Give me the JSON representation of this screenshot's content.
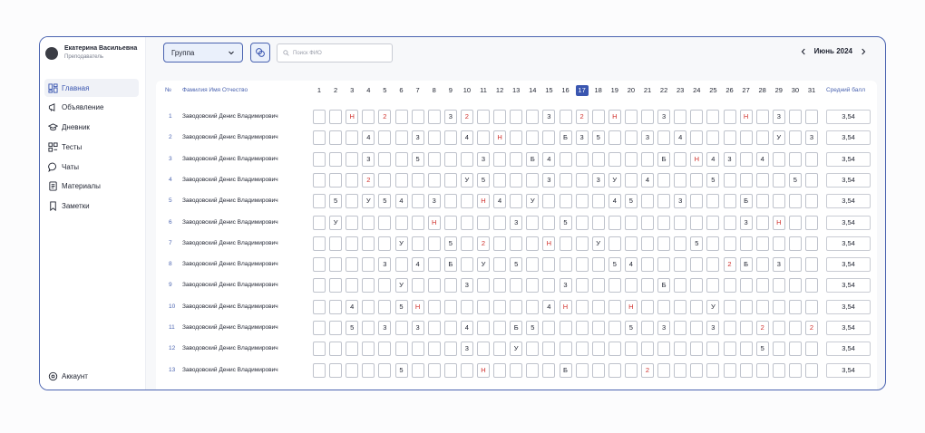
{
  "profile": {
    "name": "Екатерина Васильевна",
    "role": "Преподаватель"
  },
  "nav": [
    {
      "label": "Главная",
      "icon": "dashboard-icon",
      "active": true
    },
    {
      "label": "Объявление",
      "icon": "megaphone-icon"
    },
    {
      "label": "Дневник",
      "icon": "graduation-cap-icon"
    },
    {
      "label": "Тесты",
      "icon": "tests-icon"
    },
    {
      "label": "Чаты",
      "icon": "chat-icon"
    },
    {
      "label": "Материалы",
      "icon": "document-icon"
    },
    {
      "label": "Заметки",
      "icon": "bookmark-icon"
    }
  ],
  "account_label": "Аккаунт",
  "toolbar": {
    "group_label": "Группа",
    "search_placeholder": "Поиск ФИО",
    "month_label": "Июнь 2024"
  },
  "table": {
    "num_header": "№",
    "name_header": "Фамилия Имя Отчество",
    "avg_header": "Средний балл",
    "days": [
      "1",
      "2",
      "3",
      "4",
      "5",
      "6",
      "7",
      "8",
      "9",
      "10",
      "11",
      "12",
      "13",
      "14",
      "15",
      "16",
      "17",
      "18",
      "19",
      "20",
      "21",
      "22",
      "23",
      "24",
      "25",
      "26",
      "27",
      "28",
      "29",
      "30",
      "31"
    ],
    "today": "17",
    "rows": [
      {
        "num": "1",
        "name": "Заводовский Денис Владимирович",
        "avg": "3,54",
        "grades": [
          "",
          "",
          "Н",
          "",
          "2",
          "",
          "",
          "",
          "3",
          "2",
          "",
          "",
          "",
          "",
          "3",
          "",
          "2",
          "",
          "Н",
          "",
          "",
          "3",
          "",
          "",
          "",
          "",
          "Н",
          "",
          "3",
          "",
          ""
        ]
      },
      {
        "num": "2",
        "name": "Заводовский Денис Владимирович",
        "avg": "3,54",
        "grades": [
          "",
          "",
          "",
          "4",
          "",
          "",
          "3",
          "",
          "",
          "4",
          "",
          "Н",
          "",
          "",
          "",
          "Б",
          "3",
          "5",
          "",
          "",
          "3",
          "",
          "4",
          "",
          "",
          "",
          "",
          "",
          "У",
          "",
          "3"
        ]
      },
      {
        "num": "3",
        "name": "Заводовский Денис Владимирович",
        "avg": "3,54",
        "grades": [
          "",
          "",
          "",
          "3",
          "",
          "",
          "5",
          "",
          "",
          "",
          "3",
          "",
          "",
          "Б",
          "4",
          "",
          "",
          "",
          "",
          "",
          "",
          "Б",
          "",
          "Н",
          "4",
          "3",
          "",
          "4",
          "",
          "",
          ""
        ]
      },
      {
        "num": "4",
        "name": "Заводовский Денис Владимирович",
        "avg": "3,54",
        "grades": [
          "",
          "",
          "",
          "2",
          "",
          "",
          "",
          "",
          "",
          "У",
          "5",
          "",
          "",
          "",
          "3",
          "",
          "",
          "3",
          "У",
          "",
          "4",
          "",
          "",
          "",
          "5",
          "",
          "",
          "",
          "",
          "5",
          ""
        ]
      },
      {
        "num": "5",
        "name": "Заводовский Денис Владимирович",
        "avg": "3,54",
        "grades": [
          "",
          "5",
          "",
          "У",
          "5",
          "4",
          "",
          "3",
          "",
          "",
          "Н",
          "4",
          "",
          "У",
          "",
          "",
          "",
          "",
          "4",
          "5",
          "",
          "",
          "3",
          "",
          "",
          "",
          "Б",
          "",
          "",
          "",
          ""
        ]
      },
      {
        "num": "6",
        "name": "Заводовский Денис Владимирович",
        "avg": "3,54",
        "grades": [
          "",
          "У",
          "",
          "",
          "",
          "",
          "",
          "Н",
          "",
          "",
          "",
          "",
          "3",
          "",
          "",
          "5",
          "",
          "",
          "",
          "",
          "",
          "",
          "",
          "",
          "",
          "",
          "3",
          "",
          "Н",
          "",
          ""
        ]
      },
      {
        "num": "7",
        "name": "Заводовский Денис Владимирович",
        "avg": "3,54",
        "grades": [
          "",
          "",
          "",
          "",
          "",
          "У",
          "",
          "",
          "5",
          "",
          "2",
          "",
          "",
          "",
          "Н",
          "",
          "",
          "У",
          "",
          "",
          "",
          "",
          "",
          "5",
          "",
          "",
          "",
          "",
          "",
          "",
          ""
        ]
      },
      {
        "num": "8",
        "name": "Заводовский Денис Владимирович",
        "avg": "3,54",
        "grades": [
          "",
          "",
          "",
          "",
          "3",
          "",
          "4",
          "",
          "Б",
          "",
          "У",
          "",
          "5",
          "",
          "",
          "",
          "",
          "",
          "5",
          "4",
          "",
          "",
          "",
          "",
          "",
          "2",
          "Б",
          "",
          "3",
          "",
          ""
        ]
      },
      {
        "num": "9",
        "name": "Заводовский Денис Владимирович",
        "avg": "3,54",
        "grades": [
          "",
          "",
          "",
          "",
          "",
          "У",
          "",
          "",
          "",
          "3",
          "",
          "",
          "",
          "",
          "",
          "3",
          "",
          "",
          "",
          "",
          "",
          "Б",
          "",
          "",
          "",
          "",
          "",
          "",
          "",
          "",
          ""
        ]
      },
      {
        "num": "10",
        "name": "Заводовский Денис Владимирович",
        "avg": "3,54",
        "grades": [
          "",
          "",
          "4",
          "",
          "",
          "5",
          "Н",
          "",
          "",
          "",
          "",
          "",
          "",
          "",
          "4",
          "Н",
          "",
          "",
          "",
          "Н",
          "",
          "",
          "",
          "",
          "У",
          "",
          "",
          "",
          "",
          "",
          ""
        ]
      },
      {
        "num": "11",
        "name": "Заводовский Денис Владимирович",
        "avg": "3,54",
        "grades": [
          "",
          "",
          "5",
          "",
          "3",
          "",
          "3",
          "",
          "",
          "4",
          "",
          "",
          "Б",
          "5",
          "",
          "",
          "",
          "",
          "",
          "5",
          "",
          "3",
          "",
          "",
          "3",
          "",
          "",
          "2",
          "",
          "",
          "2"
        ]
      },
      {
        "num": "12",
        "name": "Заводовский Денис Владимирович",
        "avg": "3,54",
        "grades": [
          "",
          "",
          "",
          "",
          "",
          "",
          "",
          "",
          "",
          "3",
          "",
          "",
          "У",
          "",
          "",
          "",
          "",
          "",
          "",
          "",
          "",
          "",
          "",
          "",
          "",
          "",
          "",
          "5",
          "",
          "",
          ""
        ]
      },
      {
        "num": "13",
        "name": "Заводовский Денис Владимирович",
        "avg": "3,54",
        "grades": [
          "",
          "",
          "",
          "",
          "",
          "5",
          "",
          "",
          "",
          "",
          "Н",
          "",
          "",
          "",
          "",
          "Б",
          "",
          "",
          "",
          "",
          "2",
          "",
          "",
          "",
          "",
          "",
          "",
          "",
          "",
          "",
          ""
        ]
      }
    ]
  }
}
